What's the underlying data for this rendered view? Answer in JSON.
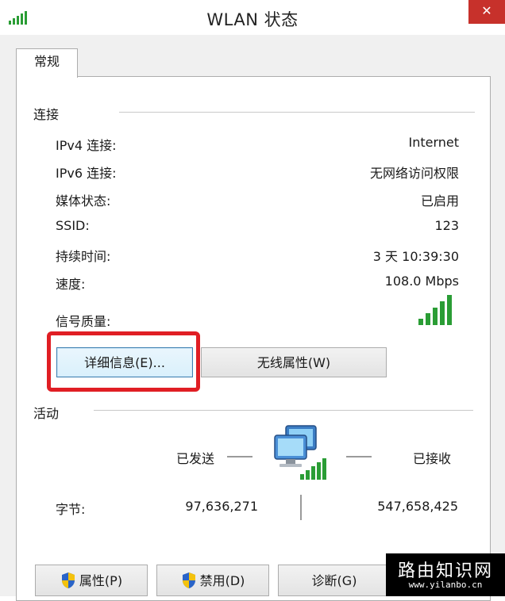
{
  "window": {
    "title": "WLAN 状态",
    "close_label": "✕"
  },
  "tabs": [
    {
      "label": "常规"
    }
  ],
  "connection": {
    "group_label": "连接",
    "rows": [
      {
        "label": "IPv4 连接:",
        "value": "Internet"
      },
      {
        "label": "IPv6 连接:",
        "value": "无网络访问权限"
      },
      {
        "label": "媒体状态:",
        "value": "已启用"
      },
      {
        "label": "SSID:",
        "value": "123"
      },
      {
        "label": "持续时间:",
        "value": "3 天 10:39:30"
      },
      {
        "label": "速度:",
        "value": "108.0 Mbps"
      }
    ],
    "signal_label": "信号质量:",
    "signal_icon": "signal-strength-icon",
    "signal_bars": 5,
    "details_button": "详细信息(E)...",
    "wireless_props_button": "无线属性(W)"
  },
  "activity": {
    "group_label": "活动",
    "sent_label": "已发送",
    "received_label": "已接收",
    "bytes_label": "字节:",
    "bytes_sent": "97,636,271",
    "bytes_received": "547,658,425",
    "network_icon": "network-computers-icon"
  },
  "buttons": {
    "properties": "属性(P)",
    "disable": "禁用(D)",
    "diagnose": "诊断(G)"
  },
  "watermark": {
    "main": "路由知识网",
    "sub": "www.yilanbo.cn"
  },
  "colors": {
    "close": "#c7312b",
    "signal": "#2a9d35",
    "highlight": "#e01e24",
    "focus": "#3c7fb1"
  }
}
